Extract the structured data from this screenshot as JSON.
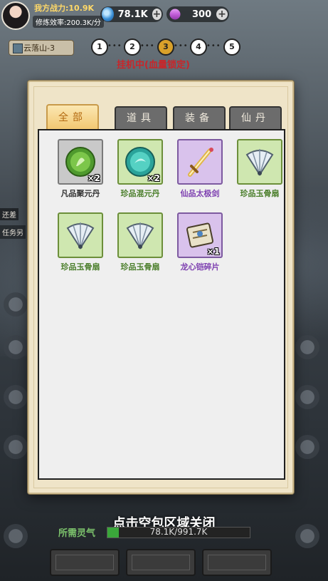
{
  "player": {
    "power_label": "我方战力:",
    "power_value": "10.9K",
    "rate": "修炼效率:200.3K/分"
  },
  "currency": [
    {
      "icon": "blue-orb-icon",
      "value": "78.1K",
      "color": "#3a8fd6"
    },
    {
      "icon": "purple-crystal-icon",
      "value": "300",
      "color": "#c25fd8"
    }
  ],
  "stage": {
    "name": "云落山-3",
    "steps": [
      "1",
      "2",
      "3",
      "4",
      "5"
    ],
    "active_step": "3"
  },
  "status": {
    "idle": "挂机中(血量锁定)"
  },
  "tabs": [
    {
      "label": "全部",
      "active": true
    },
    {
      "label": "道具",
      "active": false
    },
    {
      "label": "装备",
      "active": false
    },
    {
      "label": "仙丹",
      "active": false
    }
  ],
  "items": [
    {
      "name": "凡品聚元丹",
      "qty": "×2",
      "rarity": "gray",
      "icon": "green-pill-icon"
    },
    {
      "name": "珍品混元丹",
      "qty": "×2",
      "rarity": "green",
      "icon": "teal-pill-icon"
    },
    {
      "name": "仙品太极剑",
      "qty": "",
      "rarity": "purple",
      "icon": "sword-icon"
    },
    {
      "name": "珍品玉骨扇",
      "qty": "",
      "rarity": "green",
      "icon": "jade-fan-icon"
    },
    {
      "name": "珍品玉骨扇",
      "qty": "",
      "rarity": "green",
      "icon": "jade-fan-icon"
    },
    {
      "name": "珍品玉骨扇",
      "qty": "",
      "rarity": "green",
      "icon": "jade-fan-icon"
    },
    {
      "name": "龙心铠碎片",
      "qty": "×1",
      "rarity": "purple",
      "icon": "armor-fragment-icon"
    }
  ],
  "bottom": {
    "close_hint": "点击空包区域关闭",
    "need_label": "所需灵气",
    "need_text": "78.1K/991.7K",
    "need_progress": 0.079
  },
  "side": {
    "frag1": "还差",
    "frag2": "任务另"
  }
}
